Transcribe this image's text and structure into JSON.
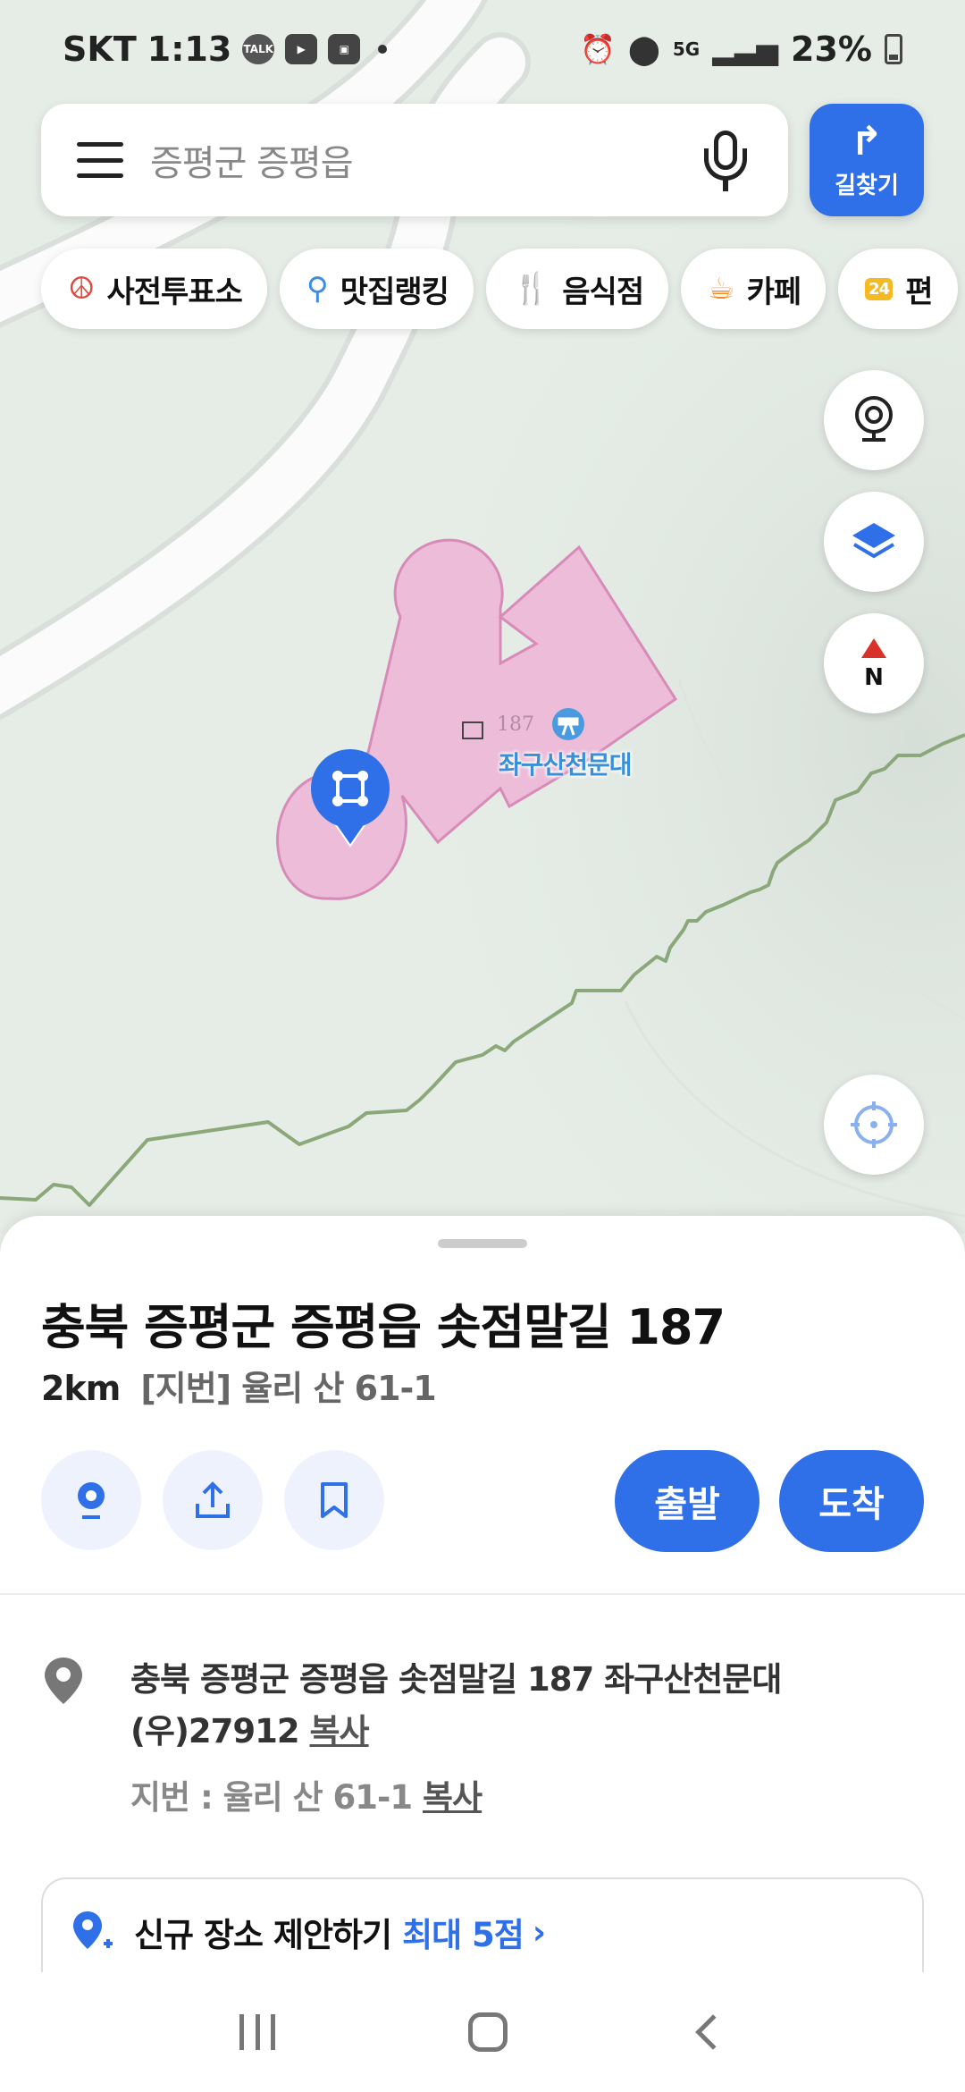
{
  "status_bar": {
    "carrier": "SKT",
    "time": "1:13",
    "network": "5G",
    "battery": "23%"
  },
  "search": {
    "query": "증평군 증평읍",
    "route_button_label": "길찾기"
  },
  "chips": [
    {
      "label": "사전투표소",
      "icon": "ballot-icon",
      "color": "#e0493e"
    },
    {
      "label": "맛집랭킹",
      "icon": "map-pin-laurel-icon",
      "color": "#3f8de0"
    },
    {
      "label": "음식점",
      "icon": "fork-knife-icon",
      "color": "#f08a24"
    },
    {
      "label": "카페",
      "icon": "coffee-cup-icon",
      "color": "#f08a24"
    },
    {
      "label": "편",
      "icon": "24h-store-icon",
      "color": "#f5b921"
    }
  ],
  "map": {
    "poi_name": "좌구산천문대",
    "poi_number": "187"
  },
  "place": {
    "title": "충북 증평군 증평읍 솟점말길 187",
    "distance": "2km",
    "jibun_summary": "[지번] 율리 산 61-1",
    "depart_label": "출발",
    "arrive_label": "도착",
    "address_full": "충북 증평군 증평읍 솟점말길 187 좌구산천문대 (우)27912",
    "copy_label": "복사",
    "jibun_line": "지번 : 율리 산 61-1",
    "suggest_label": "신규 장소 제안하기",
    "suggest_max": "최대 5점"
  },
  "colors": {
    "accent": "#2f6fe8",
    "building_fill": "#ecbcd9",
    "building_stroke": "#d88bb8",
    "contour": "#8aa879"
  }
}
